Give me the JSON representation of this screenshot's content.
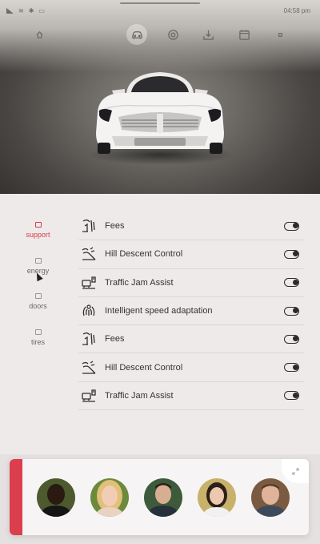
{
  "status_bar": {
    "time": "04:58 pm"
  },
  "nav": {
    "items": [
      {
        "name": "home-icon"
      },
      {
        "name": "car-icon",
        "active": true
      },
      {
        "name": "settings-icon"
      },
      {
        "name": "download-icon"
      },
      {
        "name": "calendar-icon"
      },
      {
        "name": "menu-dot-icon"
      }
    ]
  },
  "sidebar": {
    "items": [
      {
        "label": "support",
        "active": true
      },
      {
        "label": "energy"
      },
      {
        "label": "doors"
      },
      {
        "label": "tires"
      }
    ]
  },
  "features": [
    {
      "label": "Fees",
      "icon": "fees-icon",
      "enabled": true
    },
    {
      "label": "Hill Descent Control",
      "icon": "hill-descent-icon",
      "enabled": true
    },
    {
      "label": "Traffic Jam Assist",
      "icon": "traffic-jam-icon",
      "enabled": true
    },
    {
      "label": "Intelligent speed adaptation",
      "icon": "speed-adaptation-icon",
      "enabled": true
    },
    {
      "label": "Fees",
      "icon": "fees-icon",
      "enabled": true
    },
    {
      "label": "Hill Descent Control",
      "icon": "hill-descent-icon",
      "enabled": true
    },
    {
      "label": "Traffic Jam Assist",
      "icon": "traffic-jam-icon",
      "enabled": true
    }
  ],
  "contacts": [
    {
      "name": "avatar-1"
    },
    {
      "name": "avatar-2"
    },
    {
      "name": "avatar-3"
    },
    {
      "name": "avatar-4"
    },
    {
      "name": "avatar-5"
    }
  ],
  "colors": {
    "accent": "#db3e4d",
    "text": "#333333"
  }
}
